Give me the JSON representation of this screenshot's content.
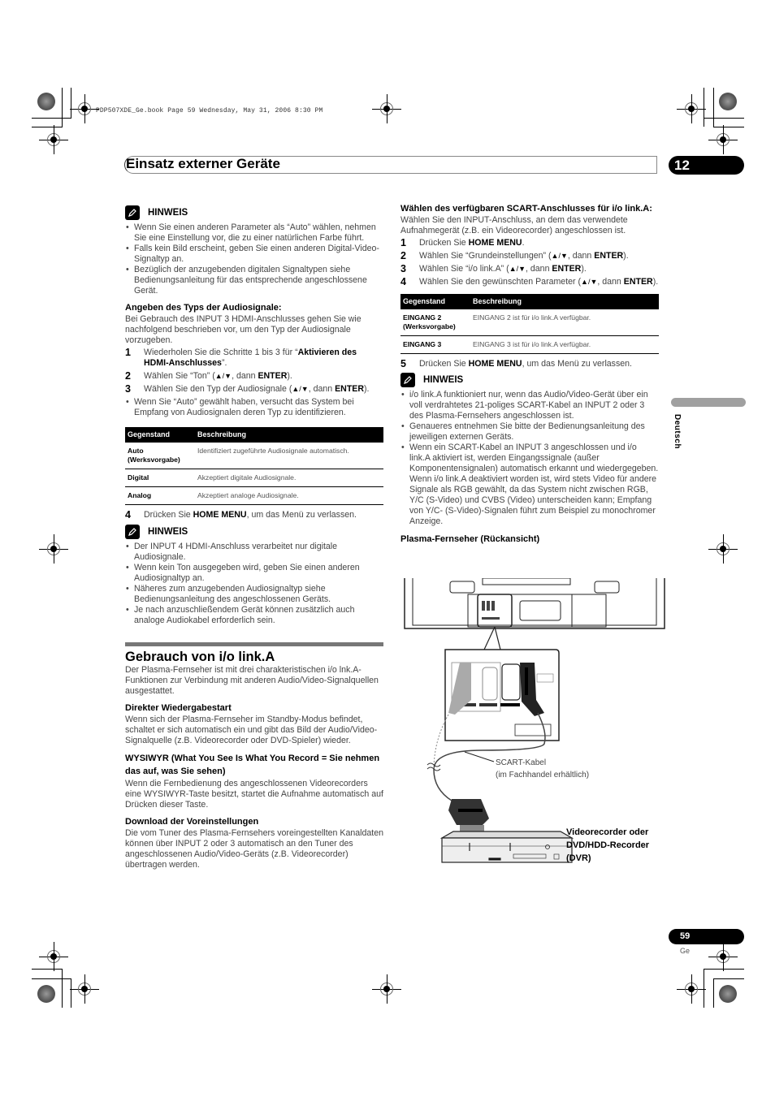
{
  "print_header": "PDP507XDE_Ge.book  Page 59  Wednesday, May 31, 2006  8:30 PM",
  "chapter": {
    "title": "Einsatz externer Geräte",
    "number": "12"
  },
  "side_tab": {
    "language": "Deutsch"
  },
  "footer": {
    "page_number": "59",
    "language_code": "Ge"
  },
  "left": {
    "note1": {
      "label": "HINWEIS",
      "icon": "pencil-note-icon",
      "items": [
        "Wenn Sie einen anderen Parameter als “Auto” wählen, nehmen Sie eine Einstellung vor, die zu einer natürlichen Farbe führt.",
        "Falls kein Bild erscheint, geben Sie einen anderen Digital-Video-Signaltyp an.",
        "Bezüglich der anzugebenden digitalen Signaltypen siehe Bedienungsanleitung für das entsprechende angeschlossene Gerät."
      ]
    },
    "audio": {
      "heading": "Angeben des Typs der Audiosignale:",
      "intro": "Bei Gebrauch des INPUT 3 HDMI-Anschlusses gehen Sie wie nachfolgend beschrieben vor, um den Typ der Audiosignale vorzugeben.",
      "steps": [
        {
          "n": "1",
          "pre": "Wiederholen Sie die Schritte 1 bis 3 für “",
          "bold": "Aktivieren des HDMI-Anschlusses",
          "post": "”."
        },
        {
          "n": "2",
          "pre": "Wählen Sie “Ton” (",
          "arrows": "▲/▼",
          "mid": ", dann ",
          "bold": "ENTER",
          "post": ")."
        },
        {
          "n": "3",
          "pre": "Wählen Sie den Typ der Audiosignale (",
          "arrows": "▲/▼",
          "mid": ", dann ",
          "bold": "ENTER",
          "post": ")."
        }
      ],
      "step3_bullet": "Wenn Sie “Auto” gewählt haben, versucht das System bei Empfang von Audiosignalen deren Typ zu identifizieren.",
      "table": {
        "headers": [
          "Gegenstand",
          "Beschreibung"
        ],
        "rows": [
          {
            "item": "Auto (Werksvorgabe)",
            "desc": "Identifiziert zugeführte Audiosignale automatisch."
          },
          {
            "item": "Digital",
            "desc": "Akzeptiert digitale Audiosignale."
          },
          {
            "item": "Analog",
            "desc": "Akzeptiert analoge Audiosignale."
          }
        ]
      },
      "step4": {
        "n": "4",
        "pre": "Drücken Sie ",
        "bold": "HOME MENU",
        "post": ", um das Menü zu verlassen."
      }
    },
    "note2": {
      "label": "HINWEIS",
      "items": [
        "Der INPUT 4 HDMI-Anschluss verarbeitet nur digitale Audiosignale.",
        "Wenn kein Ton ausgegeben wird, geben Sie einen anderen Audiosignaltyp an.",
        "Näheres zum anzugebenden Audiosignaltyp siehe Bedienungsanleitung des angeschlossenen Geräts.",
        "Je nach anzuschließendem Gerät können zusätzlich auch analoge Audiokabel erforderlich sein."
      ]
    },
    "section": {
      "title": "Gebrauch von i/o link.A",
      "intro": "Der Plasma-Fernseher ist mit drei charakteristischen i/o lnk.A-Funktionen zur Verbindung mit anderen Audio/Video-Signalquellen ausgestattet.",
      "subsections": [
        {
          "heading": "Direkter Wiedergabestart",
          "text": "Wenn sich der Plasma-Fernseher im Standby-Modus befindet, schaltet er sich automatisch ein und gibt das Bild der Audio/Video-Signalquelle (z.B. Videorecorder oder DVD-Spieler) wieder."
        },
        {
          "heading": "WYSIWYR (What You See Is What You Record = Sie nehmen das auf, was Sie sehen)",
          "text": "Wenn die Fernbedienung des angeschlossenen Videorecorders eine WYSIWYR-Taste besitzt, startet die Aufnahme automatisch auf Drücken dieser Taste."
        },
        {
          "heading": "Download der Voreinstellungen",
          "text": "Die vom Tuner des Plasma-Fernsehers voreingestellten Kanaldaten können über INPUT 2 oder 3 automatisch an den Tuner des angeschlossenen Audio/Video-Geräts (z.B. Videorecorder) übertragen werden."
        }
      ]
    }
  },
  "right": {
    "scart": {
      "heading": "Wählen des verfügbaren SCART-Anschlusses für i/o link.A:",
      "intro": "Wählen Sie den INPUT-Anschluss, an dem das verwendete Aufnahmegerät (z.B. ein Videorecorder) angeschlossen ist.",
      "steps": [
        {
          "n": "1",
          "pre": "Drücken Sie ",
          "bold": "HOME MENU",
          "post": "."
        },
        {
          "n": "2",
          "pre": "Wählen Sie “Grundeinstellungen” (",
          "arrows": "▲/▼",
          "mid": ", dann ",
          "bold": "ENTER",
          "post": ")."
        },
        {
          "n": "3",
          "pre": "Wählen Sie “i/o link.A” (",
          "arrows": "▲/▼",
          "mid": ", dann ",
          "bold": "ENTER",
          "post": ")."
        },
        {
          "n": "4",
          "pre": "Wählen Sie den gewünschten Parameter (",
          "arrows": "▲/▼",
          "mid": ", dann ",
          "bold": "ENTER",
          "post": ")."
        }
      ],
      "table": {
        "headers": [
          "Gegenstand",
          "Beschreibung"
        ],
        "rows": [
          {
            "item": "EINGANG 2 (Werksvorgabe)",
            "desc": "EINGANG 2 ist für i/o link.A verfügbar."
          },
          {
            "item": "EINGANG 3",
            "desc": "EINGANG 3 ist für i/o link.A verfügbar."
          }
        ]
      },
      "step5": {
        "n": "5",
        "pre": "Drücken Sie ",
        "bold": "HOME MENU",
        "post": ", um das Menü zu verlassen."
      }
    },
    "note3": {
      "label": "HINWEIS",
      "items": [
        "i/o link.A funktioniert nur, wenn das Audio/Video-Gerät über ein voll verdrahtetes 21-poliges SCART-Kabel an INPUT 2 oder 3 des Plasma-Fernsehers angeschlossen ist.",
        "Genaueres entnehmen Sie bitte der Bedienungsanleitung des jeweiligen externen Geräts.",
        "Wenn ein SCART-Kabel an INPUT 3 angeschlossen und i/o link.A aktiviert ist, werden Eingangssignale (außer Komponentensignalen) automatisch erkannt und wiedergegeben. Wenn i/o link.A deaktiviert worden ist, wird stets Video für andere Signale als RGB gewählt, da das System nicht zwischen RGB, Y/C (S-Video) und CVBS (Video) unterscheiden kann; Empfang von Y/C- (S-Video)-Signalen führt zum Beispiel zu monochromer Anzeige."
      ]
    },
    "diagram": {
      "title": "Plasma-Fernseher (Rückansicht)",
      "cable_label_line1": "SCART-Kabel",
      "cable_label_line2": "(im Fachhandel erhältlich)",
      "recorder_label_line1": "Videorecorder oder",
      "recorder_label_line2": "DVD/HDD-Recorder",
      "recorder_label_line3": "(DVR)"
    }
  }
}
